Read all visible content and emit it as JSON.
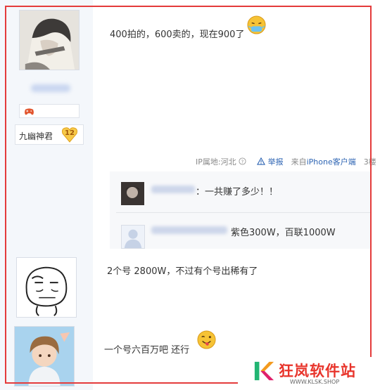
{
  "posts": [
    {
      "username": "九幽神君",
      "level": "12",
      "content": "400拍的，600卖的，现在900了",
      "meta": {
        "ip_location": "IP属地:河北",
        "report": "举报",
        "source_prefix": "来自",
        "source_link": "iPhone客户端",
        "floor": "3楼"
      },
      "replies": [
        {
          "text": "：一共赚了多少！！"
        },
        {
          "text": "紫色300W，百联1000W"
        }
      ]
    },
    {
      "content": "2个号 2800W，不过有个号出稀有了"
    },
    {
      "content": "一个号六百万吧 还行"
    }
  ],
  "watermark": {
    "logo_letter": "K",
    "brand_name": "狂岚软件站",
    "brand_url": "WWW.KLSK.SHOP",
    "colors": {
      "green": "#22b573",
      "orange": "#f39a1e",
      "red": "#e8342b",
      "pink": "#e0206b"
    }
  },
  "icons": [
    "question-icon",
    "warning-triangle-icon",
    "gamepad-icon",
    "level-heart-badge"
  ]
}
